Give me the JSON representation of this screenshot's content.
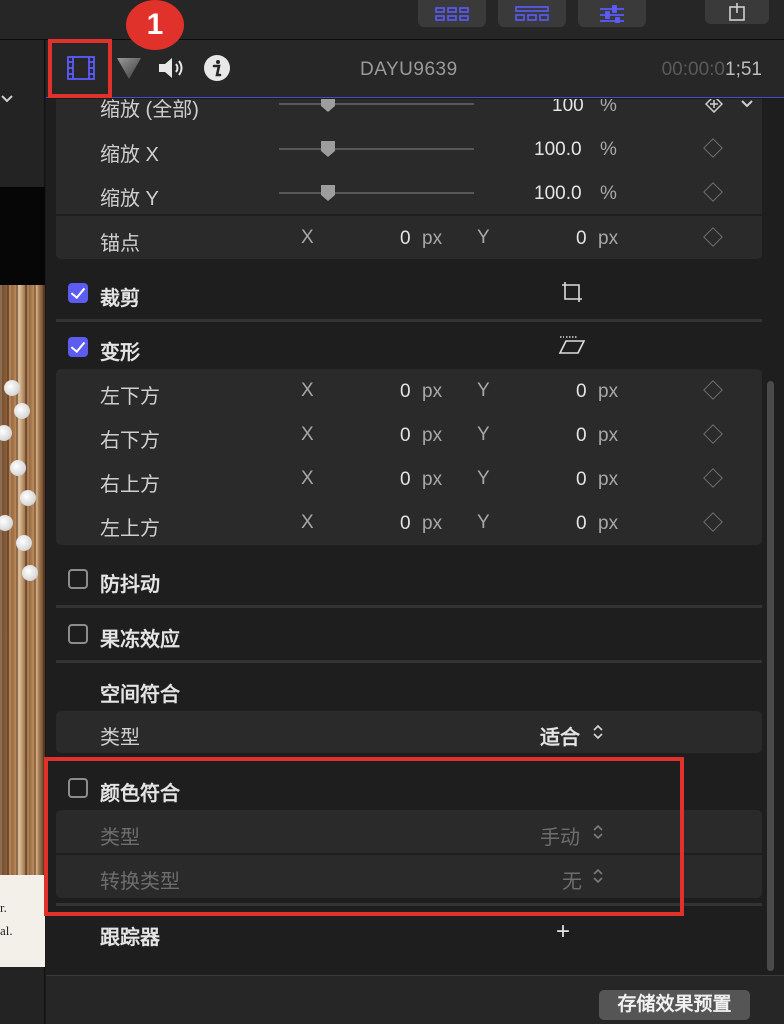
{
  "header": {
    "clip_name": "DAYU9639",
    "timecode_dim": "00:00:0",
    "timecode_bright": "1;51",
    "step_badge": "1"
  },
  "transform": {
    "scale_all": {
      "label": "缩放 (全部)",
      "value": "100",
      "unit": "%"
    },
    "scale_x": {
      "label": "缩放 X",
      "value": "100.0",
      "unit": "%"
    },
    "scale_y": {
      "label": "缩放 Y",
      "value": "100.0",
      "unit": "%"
    },
    "anchor": {
      "label": "锚点",
      "x_axis": "X",
      "x_value": "0",
      "x_unit": "px",
      "y_axis": "Y",
      "y_value": "0",
      "y_unit": "px"
    }
  },
  "crop": {
    "label": "裁剪"
  },
  "distort": {
    "label": "变形",
    "points": [
      {
        "label": "左下方",
        "x_axis": "X",
        "x_value": "0",
        "x_unit": "px",
        "y_axis": "Y",
        "y_value": "0",
        "y_unit": "px"
      },
      {
        "label": "右下方",
        "x_axis": "X",
        "x_value": "0",
        "x_unit": "px",
        "y_axis": "Y",
        "y_value": "0",
        "y_unit": "px"
      },
      {
        "label": "右上方",
        "x_axis": "X",
        "x_value": "0",
        "x_unit": "px",
        "y_axis": "Y",
        "y_value": "0",
        "y_unit": "px"
      },
      {
        "label": "左上方",
        "x_axis": "X",
        "x_value": "0",
        "x_unit": "px",
        "y_axis": "Y",
        "y_value": "0",
        "y_unit": "px"
      }
    ]
  },
  "stabilization": {
    "label": "防抖动"
  },
  "rolling_shutter": {
    "label": "果冻效应"
  },
  "spatial_conform": {
    "label": "空间符合",
    "type_label": "类型",
    "type_value": "适合"
  },
  "color_conform": {
    "label": "颜色符合",
    "type_label": "类型",
    "type_value": "手动",
    "conversion_label": "转换类型",
    "conversion_value": "无"
  },
  "tracker": {
    "label": "跟踪器",
    "add": "+"
  },
  "footer": {
    "save_preset": "存储效果预置"
  },
  "left_caption": {
    "line1": "r.",
    "line2": "al."
  },
  "colors": {
    "accent": "#5c5cf0",
    "highlight": "#e0312b"
  }
}
